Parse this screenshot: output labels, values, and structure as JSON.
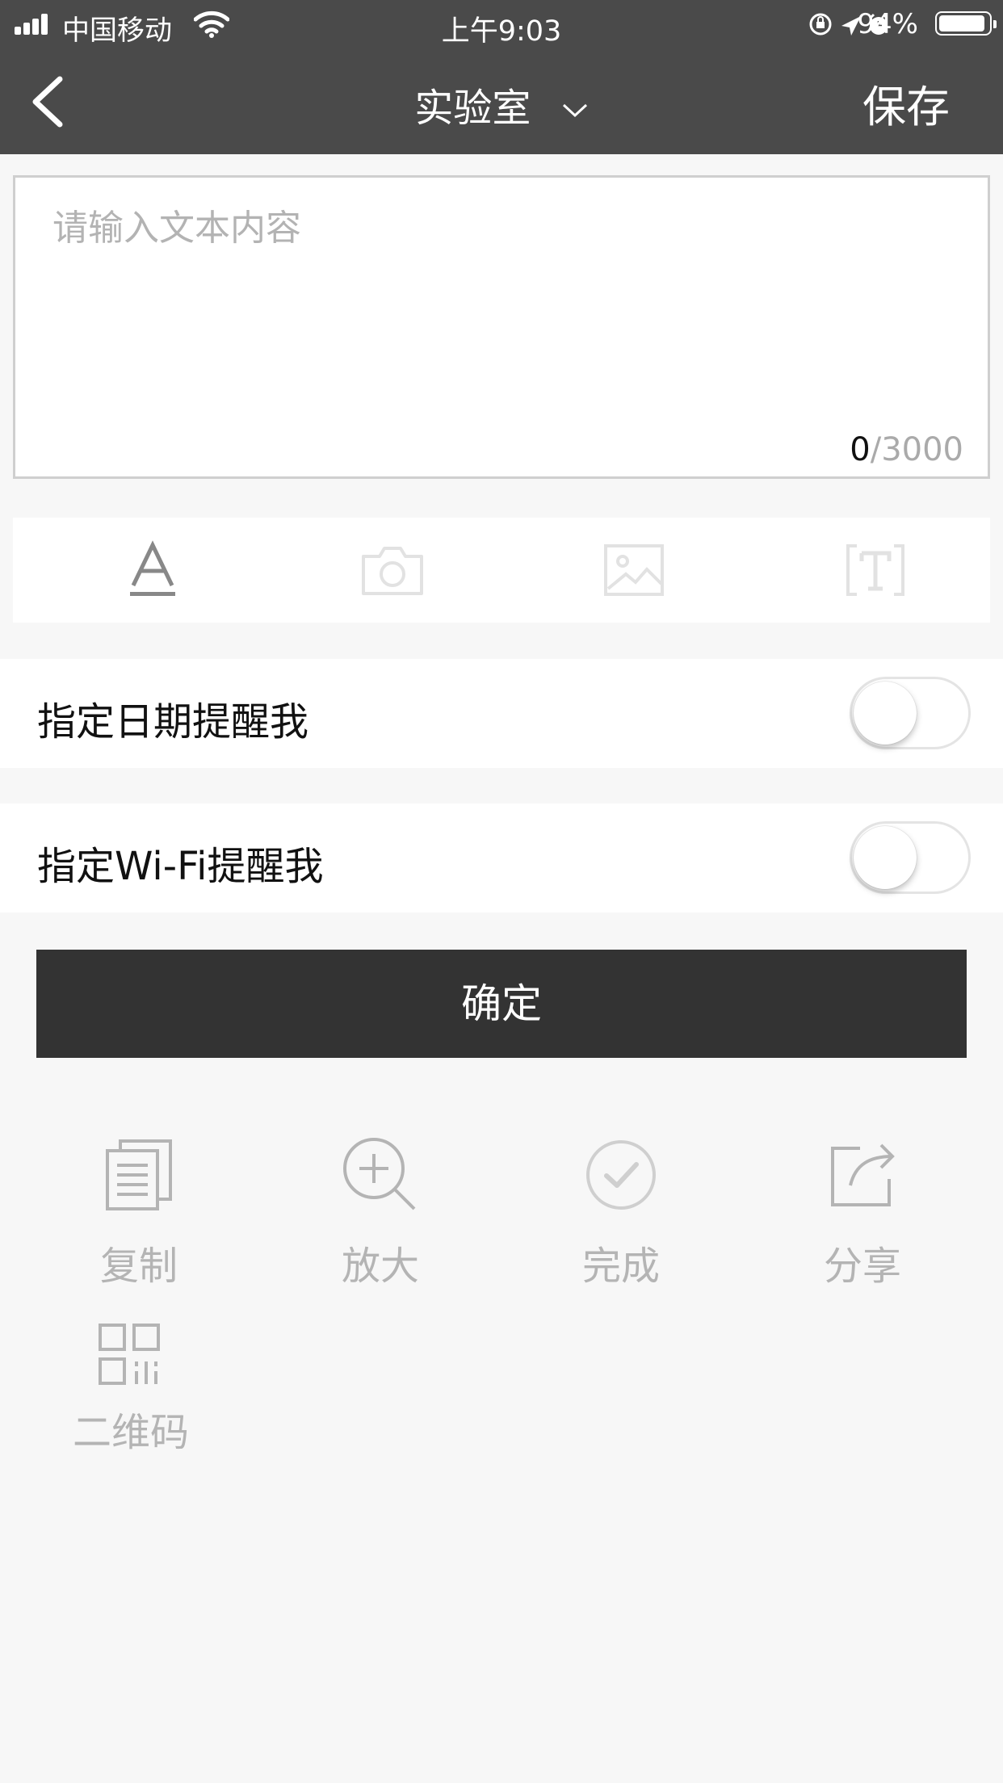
{
  "status_bar": {
    "carrier": "中国移动",
    "time": "上午9:03",
    "battery_percent": "94%",
    "battery_level": 0.94
  },
  "nav": {
    "title": "实验室",
    "save_label": "保存"
  },
  "editor": {
    "placeholder": "请输入文本内容",
    "value": "",
    "count_current": "0",
    "count_max": "/3000"
  },
  "toolbar": {
    "icons": [
      "font-style-icon",
      "camera-icon",
      "image-icon",
      "text-recognition-icon"
    ]
  },
  "reminders": {
    "date_label": "指定日期提醒我",
    "date_enabled": false,
    "wifi_label": "指定Wi-Fi提醒我",
    "wifi_enabled": false
  },
  "confirm_label": "确定",
  "actions": [
    {
      "label": "复制",
      "icon": "copy-icon"
    },
    {
      "label": "放大",
      "icon": "zoom-in-icon"
    },
    {
      "label": "完成",
      "icon": "check-circle-icon"
    },
    {
      "label": "分享",
      "icon": "share-icon"
    },
    {
      "label": "二维码",
      "icon": "qr-code-icon"
    }
  ],
  "colors": {
    "header_bg": "#4a4a4a",
    "confirm_bg": "#333333",
    "page_bg": "#f7f7f7",
    "muted_text": "#b4b4b4"
  }
}
